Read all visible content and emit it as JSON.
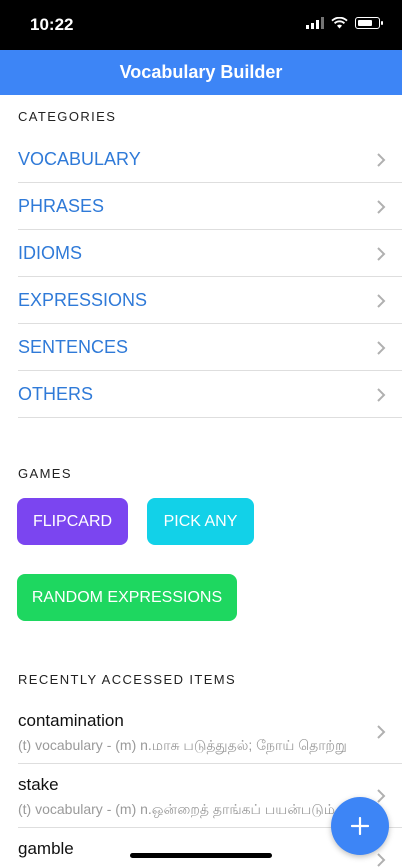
{
  "status_bar": {
    "time": "10:22"
  },
  "nav": {
    "title": "Vocabulary Builder"
  },
  "categories": {
    "header": "CATEGORIES",
    "items": [
      {
        "label": "VOCABULARY"
      },
      {
        "label": "PHRASES"
      },
      {
        "label": "IDIOMS"
      },
      {
        "label": "EXPRESSIONS"
      },
      {
        "label": "SENTENCES"
      },
      {
        "label": "OTHERS"
      }
    ]
  },
  "games": {
    "header": "GAMES",
    "buttons": [
      {
        "label": "FLIPCARD",
        "color": "#7b45f0"
      },
      {
        "label": "PICK ANY",
        "color": "#12d1e8"
      },
      {
        "label": "RANDOM EXPRESSIONS",
        "color": "#1ed760"
      }
    ]
  },
  "recent": {
    "header": "RECENTLY ACCESSED ITEMS",
    "items": [
      {
        "title": "contamination",
        "subtitle": "(t) vocabulary - (m) n.மாசு படுத்துதல்; நோய் தொற்று"
      },
      {
        "title": "stake",
        "subtitle": "(t) vocabulary - (m) n.ஒன்றைத் தாங்கப் பயன்படும் கம்பம்"
      },
      {
        "title": "gamble",
        "subtitle": ""
      }
    ]
  },
  "colors": {
    "accent": "#3d85f6",
    "link": "#2f7ad8"
  },
  "icons": [
    "signal-icon",
    "wifi-icon",
    "battery-icon",
    "chevron-right-icon",
    "plus-icon"
  ]
}
